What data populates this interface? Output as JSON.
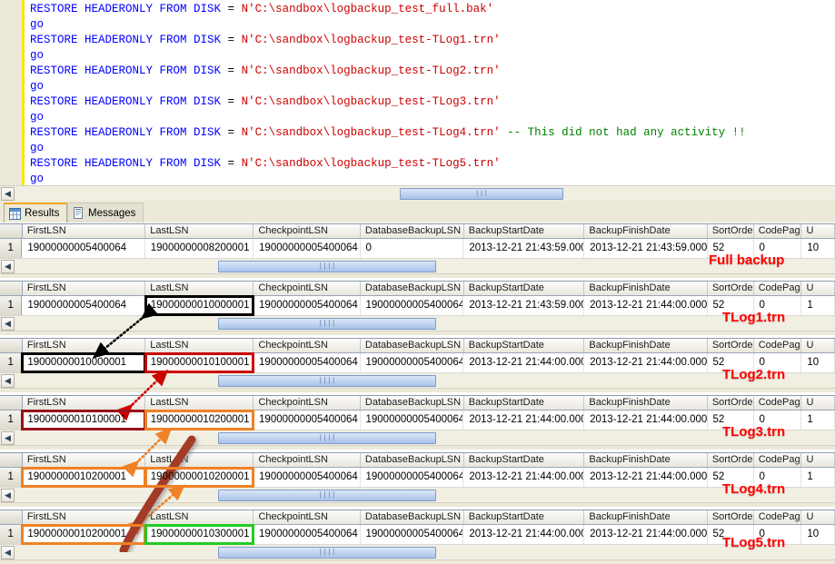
{
  "editor": {
    "lines": [
      {
        "type": "stmt",
        "kw": "RESTORE HEADERONLY FROM DISK",
        "op": " = ",
        "str": "N'C:\\sandbox\\logbackup_test_full.bak'",
        "cmt": ""
      },
      {
        "type": "go",
        "text": "go"
      },
      {
        "type": "stmt",
        "kw": "RESTORE HEADERONLY FROM DISK",
        "op": " = ",
        "str": "N'C:\\sandbox\\logbackup_test-TLog1.trn'",
        "cmt": ""
      },
      {
        "type": "go",
        "text": "go"
      },
      {
        "type": "stmt",
        "kw": "RESTORE HEADERONLY FROM DISK",
        "op": " = ",
        "str": "N'C:\\sandbox\\logbackup_test-TLog2.trn'",
        "cmt": ""
      },
      {
        "type": "go",
        "text": "go"
      },
      {
        "type": "stmt",
        "kw": "RESTORE HEADERONLY FROM DISK",
        "op": " = ",
        "str": "N'C:\\sandbox\\logbackup_test-TLog3.trn'",
        "cmt": ""
      },
      {
        "type": "go",
        "text": "go"
      },
      {
        "type": "stmt",
        "kw": "RESTORE HEADERONLY FROM DISK",
        "op": " = ",
        "str": "N'C:\\sandbox\\logbackup_test-TLog4.trn'",
        "cmt": " -- This did not had any activity !!"
      },
      {
        "type": "go",
        "text": "go"
      },
      {
        "type": "stmt",
        "kw": "RESTORE HEADERONLY FROM DISK",
        "op": " = ",
        "str": "N'C:\\sandbox\\logbackup_test-TLog5.trn'",
        "cmt": ""
      },
      {
        "type": "go",
        "text": "go"
      }
    ],
    "colors": {
      "keyword": "#0000ff",
      "string": "#cc0000",
      "comment": "#008000",
      "operator": "#000000",
      "changebar": "#ffe700"
    }
  },
  "results_tabs": [
    {
      "label": "Results",
      "icon": "grid-icon",
      "active": true
    },
    {
      "label": "Messages",
      "icon": "message-icon",
      "active": false
    }
  ],
  "columns": [
    "FirstLSN",
    "LastLSN",
    "CheckpointLSN",
    "DatabaseBackupLSN",
    "BackupStartDate",
    "BackupFinishDate",
    "SortOrder",
    "CodePage",
    "U"
  ],
  "grids": [
    {
      "annotation": "Full backup",
      "row_number": "1",
      "cells": {
        "FirstLSN": "19000000005400064",
        "LastLSN": "19000000008200001",
        "CheckpointLSN": "19000000005400064",
        "DatabaseBackupLSN": "0",
        "BackupStartDate": "2013-12-21 21:43:59.000",
        "BackupFinishDate": "2013-12-21 21:43:59.000",
        "SortOrder": "52",
        "CodePage": "0",
        "U": "10"
      },
      "highlights": []
    },
    {
      "annotation": "TLog1.trn",
      "row_number": "1",
      "cells": {
        "FirstLSN": "19000000005400064",
        "LastLSN": "19000000010000001",
        "CheckpointLSN": "19000000005400064",
        "DatabaseBackupLSN": "19000000005400064",
        "BackupStartDate": "2013-12-21 21:43:59.000",
        "BackupFinishDate": "2013-12-21 21:44:00.000",
        "SortOrder": "52",
        "CodePage": "0",
        "U": "1"
      },
      "highlights": [
        {
          "column": "LastLSN",
          "color": "#000000"
        }
      ]
    },
    {
      "annotation": "TLog2.trn",
      "row_number": "1",
      "cells": {
        "FirstLSN": "19000000010000001",
        "LastLSN": "19000000010100001",
        "CheckpointLSN": "19000000005400064",
        "DatabaseBackupLSN": "19000000005400064",
        "BackupStartDate": "2013-12-21 21:44:00.000",
        "BackupFinishDate": "2013-12-21 21:44:00.000",
        "SortOrder": "52",
        "CodePage": "0",
        "U": "10"
      },
      "highlights": [
        {
          "column": "FirstLSN",
          "color": "#000000"
        },
        {
          "column": "LastLSN",
          "color": "#cc0000"
        }
      ]
    },
    {
      "annotation": "TLog3.trn",
      "row_number": "1",
      "cells": {
        "FirstLSN": "19000000010100001",
        "LastLSN": "19000000010200001",
        "CheckpointLSN": "19000000005400064",
        "DatabaseBackupLSN": "19000000005400064",
        "BackupStartDate": "2013-12-21 21:44:00.000",
        "BackupFinishDate": "2013-12-21 21:44:00.000",
        "SortOrder": "52",
        "CodePage": "0",
        "U": "1"
      },
      "highlights": [
        {
          "column": "FirstLSN",
          "color": "#99121b"
        },
        {
          "column": "LastLSN",
          "color": "#ef8126"
        }
      ]
    },
    {
      "annotation": "TLog4.trn",
      "row_number": "1",
      "cells": {
        "FirstLSN": "19000000010200001",
        "LastLSN": "19000000010200001",
        "CheckpointLSN": "19000000005400064",
        "DatabaseBackupLSN": "19000000005400064",
        "BackupStartDate": "2013-12-21 21:44:00.000",
        "BackupFinishDate": "2013-12-21 21:44:00.000",
        "SortOrder": "52",
        "CodePage": "0",
        "U": "1"
      },
      "highlights": [
        {
          "column": "FirstLSN",
          "color": "#ef8126"
        },
        {
          "column": "LastLSN",
          "color": "#ef8126"
        }
      ]
    },
    {
      "annotation": "TLog5.trn",
      "row_number": "1",
      "cells": {
        "FirstLSN": "19000000010200001",
        "LastLSN": "19000000010300001",
        "CheckpointLSN": "19000000005400064",
        "DatabaseBackupLSN": "19000000005400064",
        "BackupStartDate": "2013-12-21 21:44:00.000",
        "BackupFinishDate": "2013-12-21 21:44:00.000",
        "SortOrder": "52",
        "CodePage": "0",
        "U": "10"
      },
      "highlights": [
        {
          "column": "FirstLSN",
          "color": "#ef8126"
        },
        {
          "column": "LastLSN",
          "color": "#22cc22"
        }
      ]
    }
  ],
  "annotation_colors": {
    "label": "#ff0000",
    "arrow_black": "#000000",
    "arrow_red": "#cc0000",
    "arrow_orange": "#ef8126",
    "brush_darkred": "#a33a28"
  }
}
